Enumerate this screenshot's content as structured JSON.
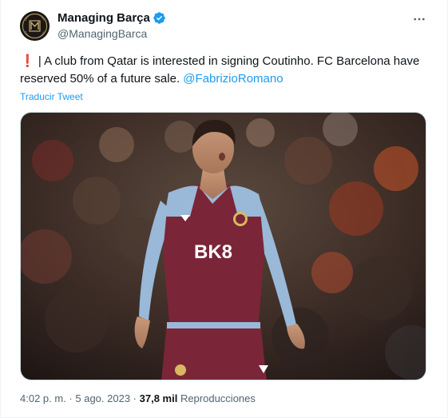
{
  "author": {
    "display_name": "Managing Barça",
    "handle": "@ManagingBarca",
    "verified": true,
    "avatar_icon": "managing-barca-logo"
  },
  "tweet": {
    "emoji": "❗",
    "text": " | A club from Qatar is interested in signing Coutinho. FC Barcelona have reserved 50% of a future sale. ",
    "mention": "@FabrizioRomano",
    "translate_label": "Traducir Tweet"
  },
  "media": {
    "shirt_sponsor": "BK8",
    "description_icon": "player-photo"
  },
  "meta": {
    "time": "4:02 p. m.",
    "sep1": " · ",
    "date": "5 ago. 2023",
    "sep2": " · ",
    "views_count": "37,8 mil",
    "views_label": " Reproducciones"
  },
  "colors": {
    "accent": "#1d9bf0",
    "text": "#0f1419",
    "secondary": "#536471",
    "claret": "#7a2538",
    "sky": "#9ab8d8"
  }
}
